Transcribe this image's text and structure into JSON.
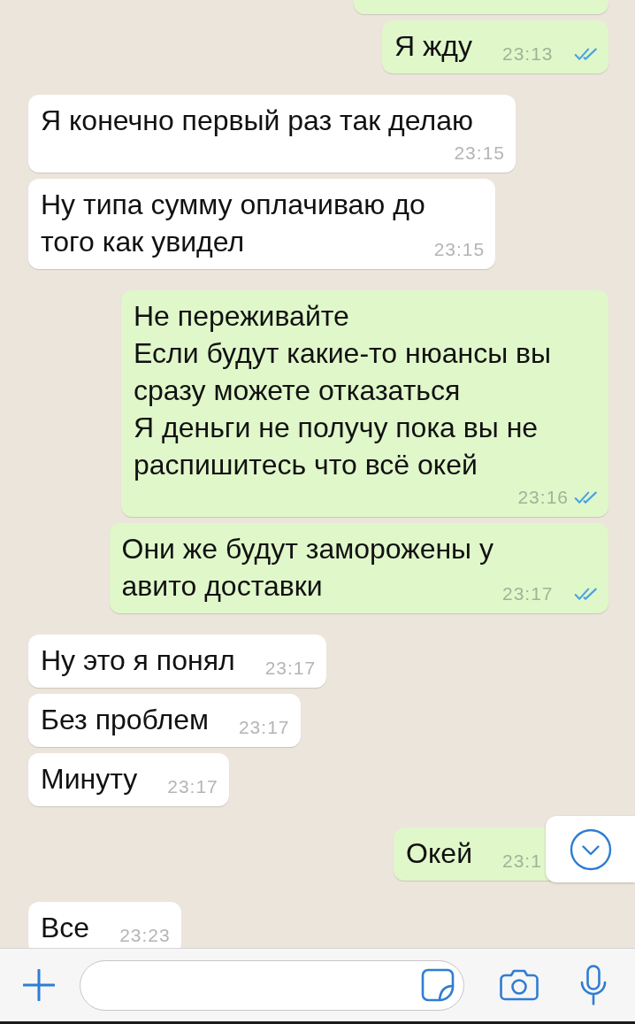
{
  "messages": [
    {
      "kind": "clipped",
      "outgoing": true
    },
    {
      "kind": "text",
      "outgoing": true,
      "text": "Я жду",
      "time": "23:13",
      "read_ticks": true
    },
    {
      "kind": "text",
      "outgoing": false,
      "text": "Я конечно первый раз так делаю",
      "time": "23:15",
      "read_ticks": false
    },
    {
      "kind": "text",
      "outgoing": false,
      "text": "Ну типа сумму оплачиваю до\nтого как увидел",
      "time": "23:15",
      "read_ticks": false
    },
    {
      "kind": "text",
      "outgoing": true,
      "text": "Не переживайте\nЕсли будут какие-то нюансы вы\nсразу можете отказаться\nЯ деньги не получу пока вы не\nраспишитесь что всё окей",
      "time": "23:16",
      "read_ticks": true
    },
    {
      "kind": "text",
      "outgoing": true,
      "text": "Они же будут заморожены у\nавито доставки",
      "time": "23:17",
      "read_ticks": true
    },
    {
      "kind": "text",
      "outgoing": false,
      "text": "Ну это я понял",
      "time": "23:17",
      "read_ticks": false
    },
    {
      "kind": "text",
      "outgoing": false,
      "text": "Без проблем",
      "time": "23:17",
      "read_ticks": false
    },
    {
      "kind": "text",
      "outgoing": false,
      "text": "Минуту",
      "time": "23:17",
      "read_ticks": false
    },
    {
      "kind": "text",
      "outgoing": true,
      "text": "Окей",
      "time": "23:1",
      "read_ticks": false
    },
    {
      "kind": "text",
      "outgoing": false,
      "text": "Все",
      "time": "23:23",
      "read_ticks": false
    }
  ]
}
